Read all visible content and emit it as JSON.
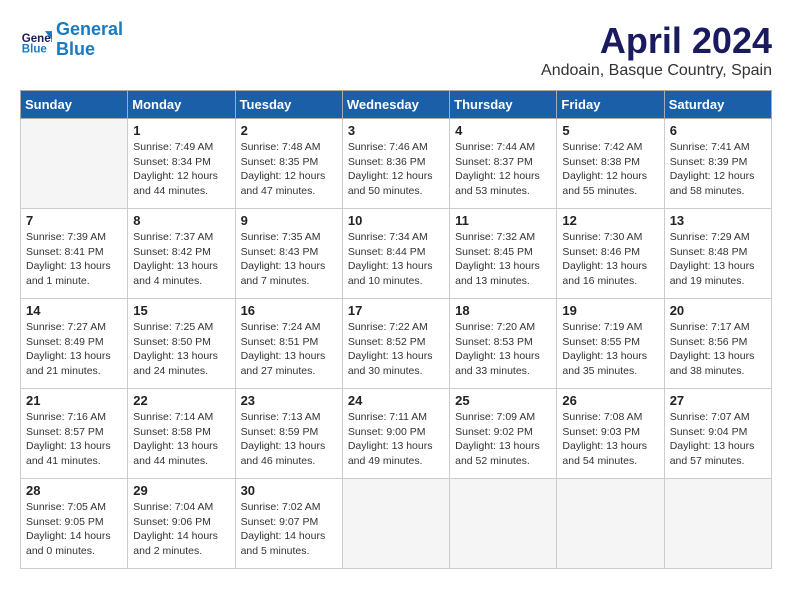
{
  "logo": {
    "line1": "General",
    "line2": "Blue"
  },
  "title": "April 2024",
  "location": "Andoain, Basque Country, Spain",
  "headers": [
    "Sunday",
    "Monday",
    "Tuesday",
    "Wednesday",
    "Thursday",
    "Friday",
    "Saturday"
  ],
  "weeks": [
    [
      {
        "day": "",
        "info": ""
      },
      {
        "day": "1",
        "info": "Sunrise: 7:49 AM\nSunset: 8:34 PM\nDaylight: 12 hours\nand 44 minutes."
      },
      {
        "day": "2",
        "info": "Sunrise: 7:48 AM\nSunset: 8:35 PM\nDaylight: 12 hours\nand 47 minutes."
      },
      {
        "day": "3",
        "info": "Sunrise: 7:46 AM\nSunset: 8:36 PM\nDaylight: 12 hours\nand 50 minutes."
      },
      {
        "day": "4",
        "info": "Sunrise: 7:44 AM\nSunset: 8:37 PM\nDaylight: 12 hours\nand 53 minutes."
      },
      {
        "day": "5",
        "info": "Sunrise: 7:42 AM\nSunset: 8:38 PM\nDaylight: 12 hours\nand 55 minutes."
      },
      {
        "day": "6",
        "info": "Sunrise: 7:41 AM\nSunset: 8:39 PM\nDaylight: 12 hours\nand 58 minutes."
      }
    ],
    [
      {
        "day": "7",
        "info": "Sunrise: 7:39 AM\nSunset: 8:41 PM\nDaylight: 13 hours\nand 1 minute."
      },
      {
        "day": "8",
        "info": "Sunrise: 7:37 AM\nSunset: 8:42 PM\nDaylight: 13 hours\nand 4 minutes."
      },
      {
        "day": "9",
        "info": "Sunrise: 7:35 AM\nSunset: 8:43 PM\nDaylight: 13 hours\nand 7 minutes."
      },
      {
        "day": "10",
        "info": "Sunrise: 7:34 AM\nSunset: 8:44 PM\nDaylight: 13 hours\nand 10 minutes."
      },
      {
        "day": "11",
        "info": "Sunrise: 7:32 AM\nSunset: 8:45 PM\nDaylight: 13 hours\nand 13 minutes."
      },
      {
        "day": "12",
        "info": "Sunrise: 7:30 AM\nSunset: 8:46 PM\nDaylight: 13 hours\nand 16 minutes."
      },
      {
        "day": "13",
        "info": "Sunrise: 7:29 AM\nSunset: 8:48 PM\nDaylight: 13 hours\nand 19 minutes."
      }
    ],
    [
      {
        "day": "14",
        "info": "Sunrise: 7:27 AM\nSunset: 8:49 PM\nDaylight: 13 hours\nand 21 minutes."
      },
      {
        "day": "15",
        "info": "Sunrise: 7:25 AM\nSunset: 8:50 PM\nDaylight: 13 hours\nand 24 minutes."
      },
      {
        "day": "16",
        "info": "Sunrise: 7:24 AM\nSunset: 8:51 PM\nDaylight: 13 hours\nand 27 minutes."
      },
      {
        "day": "17",
        "info": "Sunrise: 7:22 AM\nSunset: 8:52 PM\nDaylight: 13 hours\nand 30 minutes."
      },
      {
        "day": "18",
        "info": "Sunrise: 7:20 AM\nSunset: 8:53 PM\nDaylight: 13 hours\nand 33 minutes."
      },
      {
        "day": "19",
        "info": "Sunrise: 7:19 AM\nSunset: 8:55 PM\nDaylight: 13 hours\nand 35 minutes."
      },
      {
        "day": "20",
        "info": "Sunrise: 7:17 AM\nSunset: 8:56 PM\nDaylight: 13 hours\nand 38 minutes."
      }
    ],
    [
      {
        "day": "21",
        "info": "Sunrise: 7:16 AM\nSunset: 8:57 PM\nDaylight: 13 hours\nand 41 minutes."
      },
      {
        "day": "22",
        "info": "Sunrise: 7:14 AM\nSunset: 8:58 PM\nDaylight: 13 hours\nand 44 minutes."
      },
      {
        "day": "23",
        "info": "Sunrise: 7:13 AM\nSunset: 8:59 PM\nDaylight: 13 hours\nand 46 minutes."
      },
      {
        "day": "24",
        "info": "Sunrise: 7:11 AM\nSunset: 9:00 PM\nDaylight: 13 hours\nand 49 minutes."
      },
      {
        "day": "25",
        "info": "Sunrise: 7:09 AM\nSunset: 9:02 PM\nDaylight: 13 hours\nand 52 minutes."
      },
      {
        "day": "26",
        "info": "Sunrise: 7:08 AM\nSunset: 9:03 PM\nDaylight: 13 hours\nand 54 minutes."
      },
      {
        "day": "27",
        "info": "Sunrise: 7:07 AM\nSunset: 9:04 PM\nDaylight: 13 hours\nand 57 minutes."
      }
    ],
    [
      {
        "day": "28",
        "info": "Sunrise: 7:05 AM\nSunset: 9:05 PM\nDaylight: 14 hours\nand 0 minutes."
      },
      {
        "day": "29",
        "info": "Sunrise: 7:04 AM\nSunset: 9:06 PM\nDaylight: 14 hours\nand 2 minutes."
      },
      {
        "day": "30",
        "info": "Sunrise: 7:02 AM\nSunset: 9:07 PM\nDaylight: 14 hours\nand 5 minutes."
      },
      {
        "day": "",
        "info": ""
      },
      {
        "day": "",
        "info": ""
      },
      {
        "day": "",
        "info": ""
      },
      {
        "day": "",
        "info": ""
      }
    ]
  ]
}
